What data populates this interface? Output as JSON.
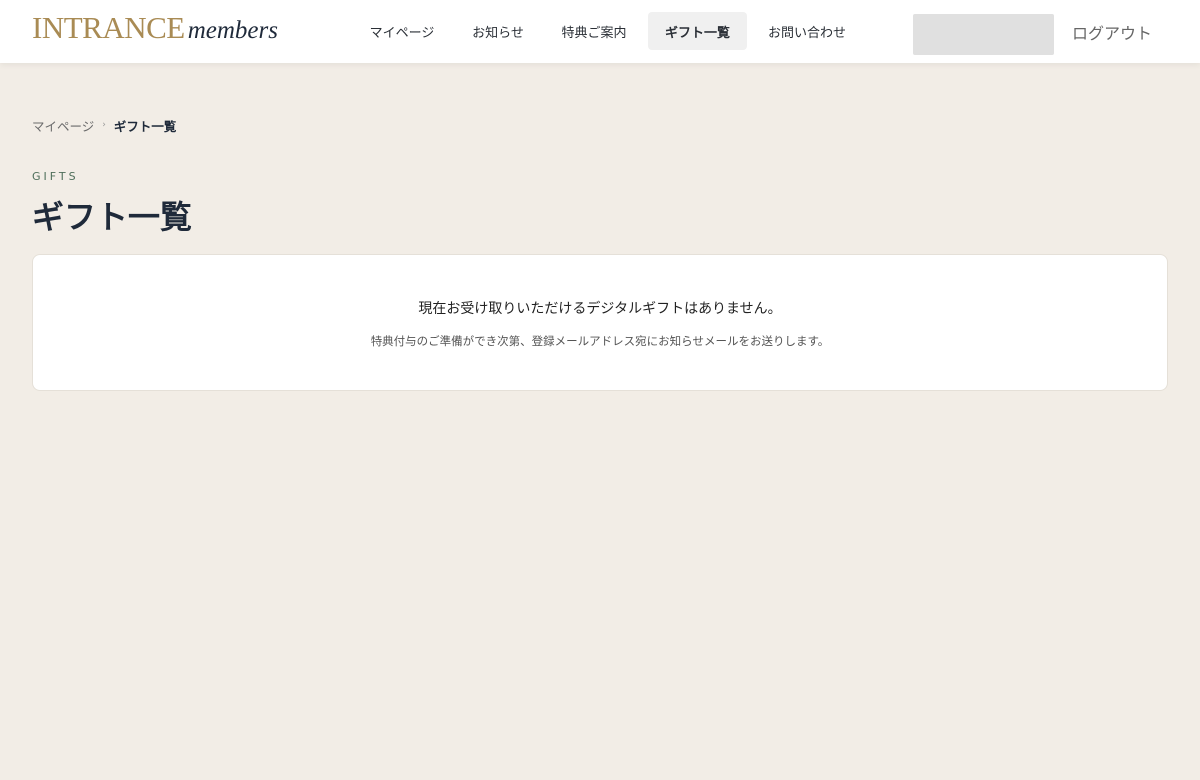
{
  "header": {
    "logo_brand": "INTRANCE",
    "logo_sub": "members",
    "nav": [
      {
        "label": "マイページ"
      },
      {
        "label": "お知らせ"
      },
      {
        "label": "特典ご案内"
      },
      {
        "label": "ギフト一覧",
        "active": true
      },
      {
        "label": "お問い合わせ"
      }
    ],
    "logout_label": "ログアウト"
  },
  "breadcrumb": {
    "home": "マイページ",
    "separator": "›",
    "current": "ギフト一覧"
  },
  "page": {
    "eyebrow": "GIFTS",
    "title": "ギフト一覧"
  },
  "empty_state": {
    "message": "現在お受け取りいただけるデジタルギフトはありません。",
    "note": "特典付与のご準備ができ次第、登録メールアドレス宛にお知らせメールをお送りします。"
  },
  "colors": {
    "page_background": "#f2ede6",
    "brand_gold": "#a98b54",
    "navy": "#1f2a3a",
    "eyebrow_green": "#4e6e5a"
  }
}
